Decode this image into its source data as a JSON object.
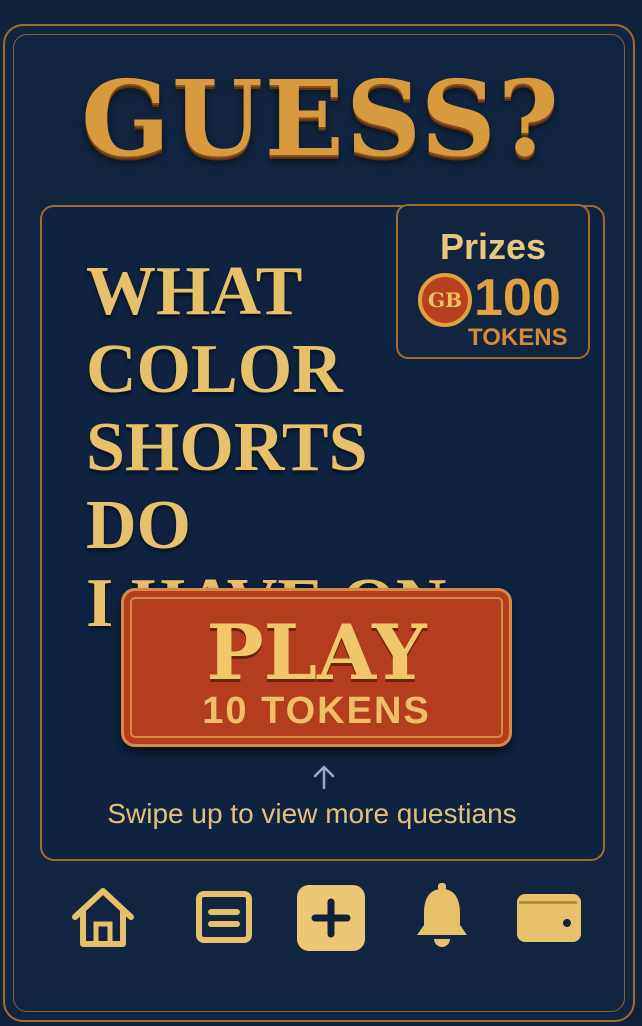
{
  "header": {
    "title": "GUESS?"
  },
  "prize": {
    "label": "Prizes",
    "coin_text": "GB",
    "amount": "100",
    "unit": "TOKENS"
  },
  "question": {
    "lines": [
      "WHAT",
      "COLOR",
      "SHORTS DO",
      "I HAVE ON"
    ]
  },
  "play_button": {
    "label": "PLAY",
    "cost": "10 TOKENS"
  },
  "swipe": {
    "icon": "arrow-up-icon",
    "text": "Swipe up to view more questians"
  },
  "nav": {
    "items": [
      {
        "icon": "home-icon"
      },
      {
        "icon": "list-icon"
      },
      {
        "icon": "plus-icon",
        "active": true
      },
      {
        "icon": "bell-icon"
      },
      {
        "icon": "wallet-icon"
      }
    ]
  },
  "colors": {
    "background": "#10213a",
    "gold": "#e6c06a",
    "orange": "#d79a3f",
    "button_red": "#b43d1d",
    "border": "#a36a2c"
  }
}
